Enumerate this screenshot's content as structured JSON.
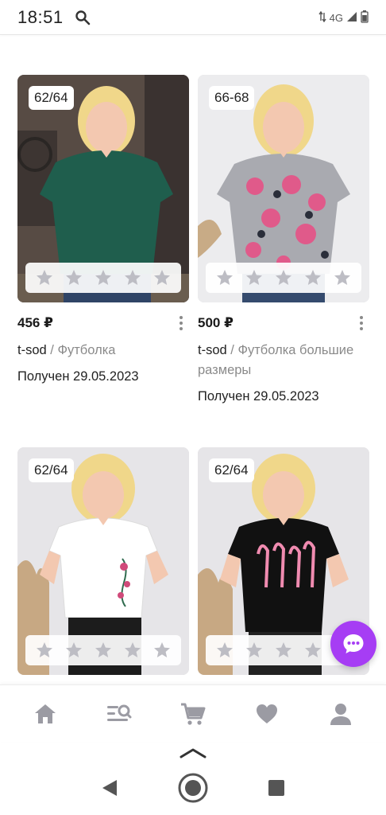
{
  "status_bar": {
    "time": "18:51",
    "network": "4G"
  },
  "products": [
    {
      "size": "62/64",
      "price": "456 ₽",
      "brand": "t-sod",
      "separator": " / ",
      "category": "Футболка",
      "received": "Получен 29.05.2023",
      "shirt_color": "#1f5e4d",
      "bg_color": "#5a4b44"
    },
    {
      "size": "66-68",
      "price": "500 ₽",
      "brand": "t-sod",
      "separator": " / ",
      "category": "Футболка большие размеры",
      "received": "Получен 29.05.2023",
      "shirt_color": "#a9aab0",
      "bg_color": "#ebebed"
    },
    {
      "size": "62/64",
      "shirt_color": "#ffffff",
      "bg_color": "#e4e3e6"
    },
    {
      "size": "62/64",
      "shirt_color": "#111111",
      "bg_color": "#e4e3e6"
    }
  ],
  "rating_stars": 5,
  "colors": {
    "accent": "#a63df4",
    "star": "#bdbdc4",
    "nav_icon": "#9b9ba3",
    "muted_text": "#8a8a8a"
  },
  "icons": {
    "status_search": "search-icon",
    "chat": "chat-bubble-icon",
    "nav": [
      "home-icon",
      "catalog-search-icon",
      "cart-icon",
      "favorites-heart-icon",
      "profile-icon"
    ]
  }
}
